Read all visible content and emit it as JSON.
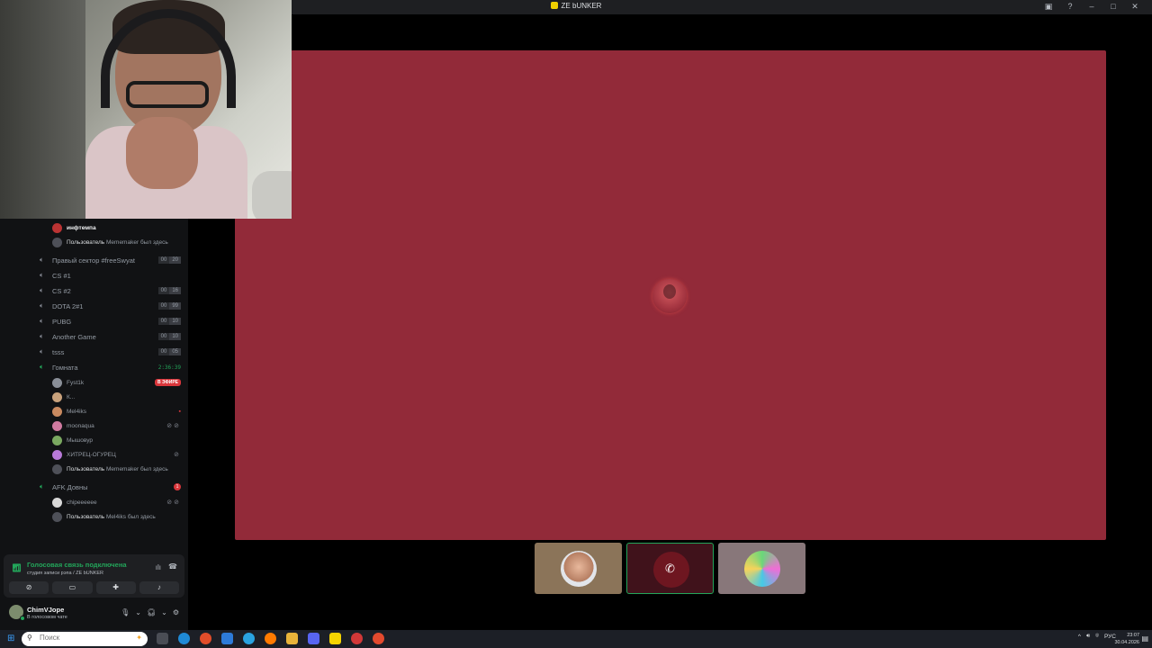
{
  "window": {
    "title": "ZE bUNKER"
  },
  "channels": [
    {
      "name": "Правый сектор #freeSwyat",
      "badge": [
        "00",
        "20"
      ]
    },
    {
      "name": "CS #1"
    },
    {
      "name": "CS #2",
      "badge": [
        "00",
        "16"
      ]
    },
    {
      "name": "DOTA 2#1",
      "badge": [
        "00",
        "99"
      ]
    },
    {
      "name": "PUBG",
      "badge": [
        "00",
        "10"
      ]
    },
    {
      "name": "Another Game",
      "badge": [
        "00",
        "10"
      ]
    },
    {
      "name": "tsss",
      "badge": [
        "00",
        "05"
      ]
    },
    {
      "name": "Гомната",
      "timer": "2:36:39"
    },
    {
      "name": "AFK Довны",
      "count": "1"
    }
  ],
  "top_users": [
    {
      "name": "инфтемпа"
    }
  ],
  "gomnata_users": [
    {
      "name": "Fyst1k",
      "live": "В ЭФИРЕ"
    },
    {
      "name": "К..."
    },
    {
      "name": "Mel4iks"
    },
    {
      "name": "moonaqua"
    },
    {
      "name": "Мышовур"
    },
    {
      "name": "ХИТРЕЦ-ОГУРЕЦ"
    }
  ],
  "afk_users": [
    {
      "name": "chipeeeeee"
    }
  ],
  "notes": {
    "prefix": "Пользователь",
    "suffix": "был здесь",
    "n1_user": "Mememaker",
    "n2_user": "Mememaker",
    "n3_user": "Mel4iks"
  },
  "voice": {
    "status": "Голосовая связь подключена",
    "sub": "студия записи рэпа / ZE bUNKER"
  },
  "user": {
    "name": "ChimVJope",
    "status": "В голосовом чате"
  },
  "taskbar": {
    "search_placeholder": "Поиск",
    "lang": "РУС",
    "time": "23:07",
    "date": "30.04.2026"
  },
  "colors": {
    "stage": "#922a39",
    "sidebar": "#111214",
    "accent_green": "#23a55a",
    "live_red": "#da373c"
  }
}
